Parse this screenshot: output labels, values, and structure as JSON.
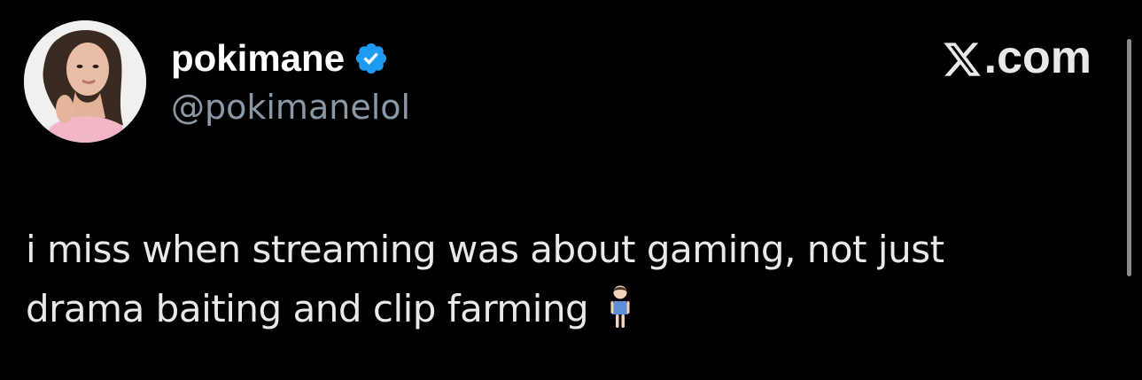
{
  "post": {
    "display_name": "pokimane",
    "handle": "@pokimanelol",
    "verified_icon": "verified-badge-icon",
    "brand_label": ".com",
    "brand_icon": "x-logo-icon",
    "text_line_1": "i miss when streaming was about gaming, not just",
    "text_line_2": "drama baiting and clip farming",
    "emoji_icon": "standing-woman-emoji-icon"
  },
  "colors": {
    "background": "#000000",
    "name": "#ffffff",
    "handle": "#8b98a5",
    "body_text": "#e7e9ea",
    "verified": "#1d9bf0",
    "scrollbar": "#8d8d8d"
  }
}
